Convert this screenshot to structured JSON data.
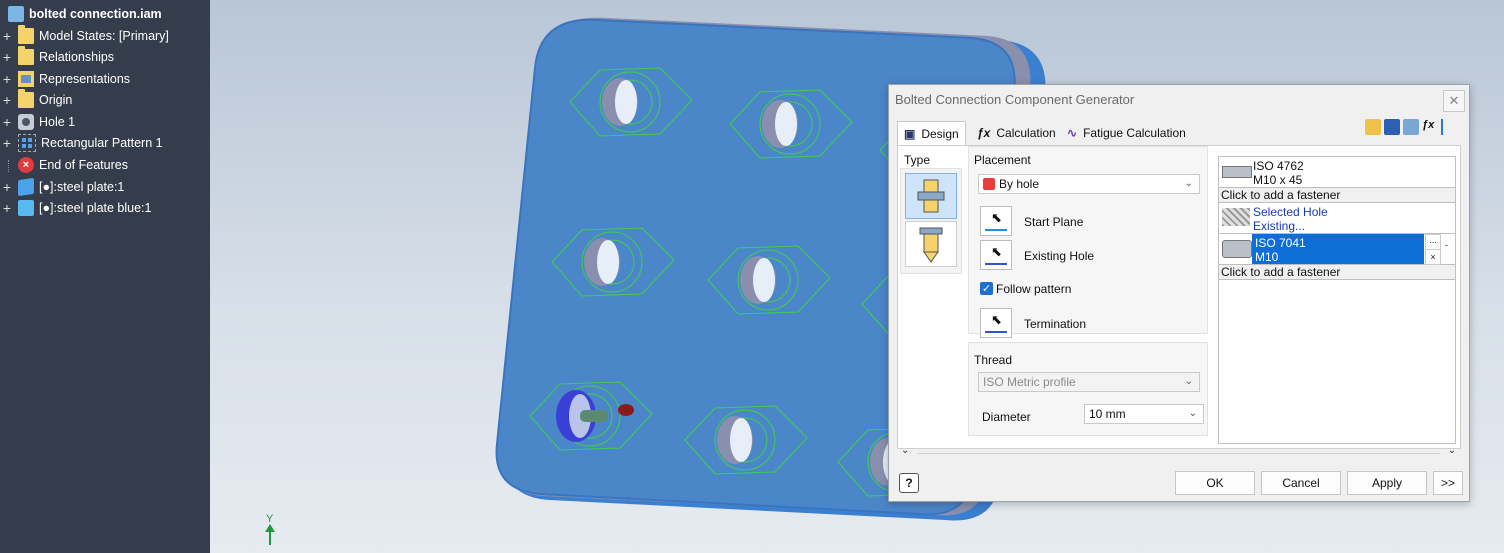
{
  "browser": {
    "root_label": "bolted connection.iam",
    "items": [
      {
        "label": "Model States: [Primary]",
        "icon": "folder-icon"
      },
      {
        "label": "Relationships",
        "icon": "folder-icon"
      },
      {
        "label": "Representations",
        "icon": "representations-icon"
      },
      {
        "label": "Origin",
        "icon": "folder-icon"
      },
      {
        "label": "Hole 1",
        "icon": "hole-feature-icon"
      },
      {
        "label": "Rectangular Pattern 1",
        "icon": "rectangular-pattern-icon"
      },
      {
        "label": "End of Features",
        "icon": "end-of-features-icon"
      },
      {
        "label": "[●]:steel plate:1",
        "icon": "part-icon"
      },
      {
        "label": "[●]:steel plate blue:1",
        "icon": "part-icon"
      }
    ]
  },
  "viewport": {
    "axis_label": "Y",
    "colors": {
      "plate": "#4b86c9",
      "plate_edge": "#3a7fd0",
      "fastener_wire": "#3cd24a"
    }
  },
  "dialog": {
    "title": "Bolted Connection Component Generator",
    "tabs": [
      "Design",
      "Calculation",
      "Fatigue Calculation"
    ],
    "type_label": "Type",
    "placement_label": "Placement",
    "placement_value": "By hole",
    "start_plane": "Start Plane",
    "existing_hole": "Existing Hole",
    "follow_pattern": "Follow pattern",
    "termination": "Termination",
    "thread_label": "Thread",
    "thread_value": "ISO Metric profile",
    "diameter_label": "Diameter",
    "diameter_value": "10 mm",
    "fasteners": {
      "bolt_name": "ISO 4762",
      "bolt_size": "M10 x 45",
      "add_fastener_1": "Click to add a fastener",
      "hole_name": "Selected Hole",
      "hole_type": "Existing...",
      "nut_name": "ISO 7041",
      "nut_size": "M10",
      "nut_more": "...",
      "nut_remove": "×",
      "add_fastener_2": "Click to add a fastener"
    },
    "buttons": {
      "ok": "OK",
      "cancel": "Cancel",
      "apply": "Apply",
      "more": ">>"
    }
  }
}
